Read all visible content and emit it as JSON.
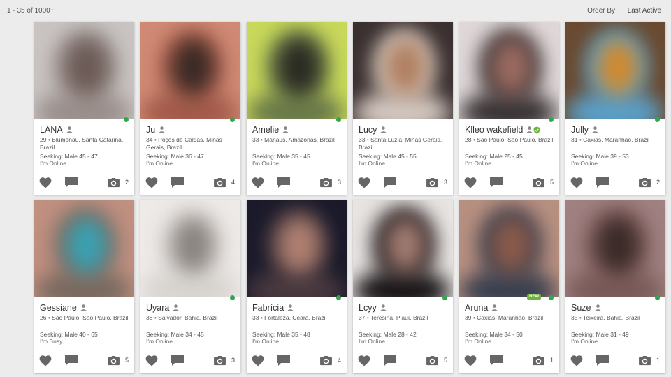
{
  "header": {
    "results_count": "1 - 35 of 1000+",
    "order_by_label": "Order By:",
    "order_by_value": "Last Active"
  },
  "colors": {
    "online": "#2fa84f",
    "verified": "#6db33f",
    "icon": "#666666"
  },
  "icons": {
    "like": "heart-icon",
    "message": "message-icon",
    "photos": "camera-icon",
    "gender": "person-icon",
    "verified": "shield-check-icon"
  },
  "profiles": [
    {
      "name": "LANA",
      "location": "29 • Blumenau, Santa Catarina, Brazil",
      "seeking": "Seeking: Male 45 - 47",
      "status": "I'm Online",
      "photos": "2",
      "online": true,
      "palette": [
        "#9a8f8c",
        "#6b5a55",
        "#c9c4c2"
      ]
    },
    {
      "name": "Ju",
      "location": "34 • Poços de Caldas, Minas Gerais, Brazil",
      "seeking": "Seeking: Male 36 - 47",
      "status": "I'm Online",
      "photos": "4",
      "online": true,
      "palette": [
        "#a35a4a",
        "#3a2a25",
        "#d08a74"
      ]
    },
    {
      "name": "Amelie",
      "location": "33 • Manaus, Amazonas, Brazil",
      "seeking": "Seeking: Male 35 - 45",
      "status": "I'm Online",
      "photos": "3",
      "online": true,
      "palette": [
        "#6a7a4a",
        "#2a2a22",
        "#c8d85a"
      ]
    },
    {
      "name": "Lucy",
      "location": "33 • Santa Luzia, Minas Gerais, Brazil",
      "seeking": "Seeking: Male 45 - 55",
      "status": "I'm Online",
      "photos": "3",
      "online": false,
      "palette": [
        "#d4c8c0",
        "#b08060",
        "#3a3030"
      ]
    },
    {
      "name": "Klleo wakefield",
      "location": "28 • São Paulo, São Paulo, Brazil",
      "seeking": "Seeking: Male 25 - 45",
      "status": "I'm Online",
      "photos": "5",
      "online": true,
      "verified": true,
      "palette": [
        "#3a3436",
        "#9a6a60",
        "#e0d8d8"
      ]
    },
    {
      "name": "Jully",
      "location": "31 • Caxias, Maranhão, Brazil",
      "seeking": "Seeking: Male 39 - 53",
      "status": "I'm Online",
      "photos": "2",
      "online": true,
      "palette": [
        "#5aa0c8",
        "#d08a30",
        "#6a4a30"
      ]
    },
    {
      "name": "Gessiane",
      "location": "26 • São Paulo, São Paulo, Brazil",
      "seeking": "Seeking: Male 40 - 65",
      "status": "I'm Busy",
      "photos": "5",
      "online": false,
      "palette": [
        "#7a6a60",
        "#3aa0b0",
        "#c09080"
      ]
    },
    {
      "name": "Uyara",
      "location": "38 • Salvador, Bahia, Brazil",
      "seeking": "Seeking: Male 34 - 45",
      "status": "I'm Online",
      "photos": "3",
      "online": true,
      "palette": [
        "#d8d4d0",
        "#8a8480",
        "#eeeae8"
      ]
    },
    {
      "name": "Fabrícia",
      "location": "33 • Fortaleza, Ceará, Brazil",
      "seeking": "Seeking: Male 35 - 48",
      "status": "I'm Online",
      "photos": "4",
      "online": true,
      "palette": [
        "#4a3a40",
        "#b08070",
        "#1a1a2a"
      ]
    },
    {
      "name": "Lcyy",
      "location": "37 • Teresina, Piauí, Brazil",
      "seeking": "Seeking: Male 28 - 42",
      "status": "I'm Online",
      "photos": "5",
      "online": true,
      "palette": [
        "#1a1618",
        "#a07a70",
        "#e8e4e2"
      ]
    },
    {
      "name": "Aruna",
      "location": "39 • Caxias, Maranhão, Brazil",
      "seeking": "Seeking: Male 34 - 50",
      "status": "I'm Online",
      "photos": "1",
      "online": true,
      "new_badge": "NEW",
      "palette": [
        "#3a4050",
        "#8a5a4a",
        "#b89080"
      ]
    },
    {
      "name": "Suze",
      "location": "35 • Teixeira, Bahia, Brazil",
      "seeking": "Seeking: Male 31 - 49",
      "status": "I'm Online",
      "photos": "1",
      "online": true,
      "palette": [
        "#7a5a58",
        "#3a2a28",
        "#a08080"
      ]
    }
  ]
}
